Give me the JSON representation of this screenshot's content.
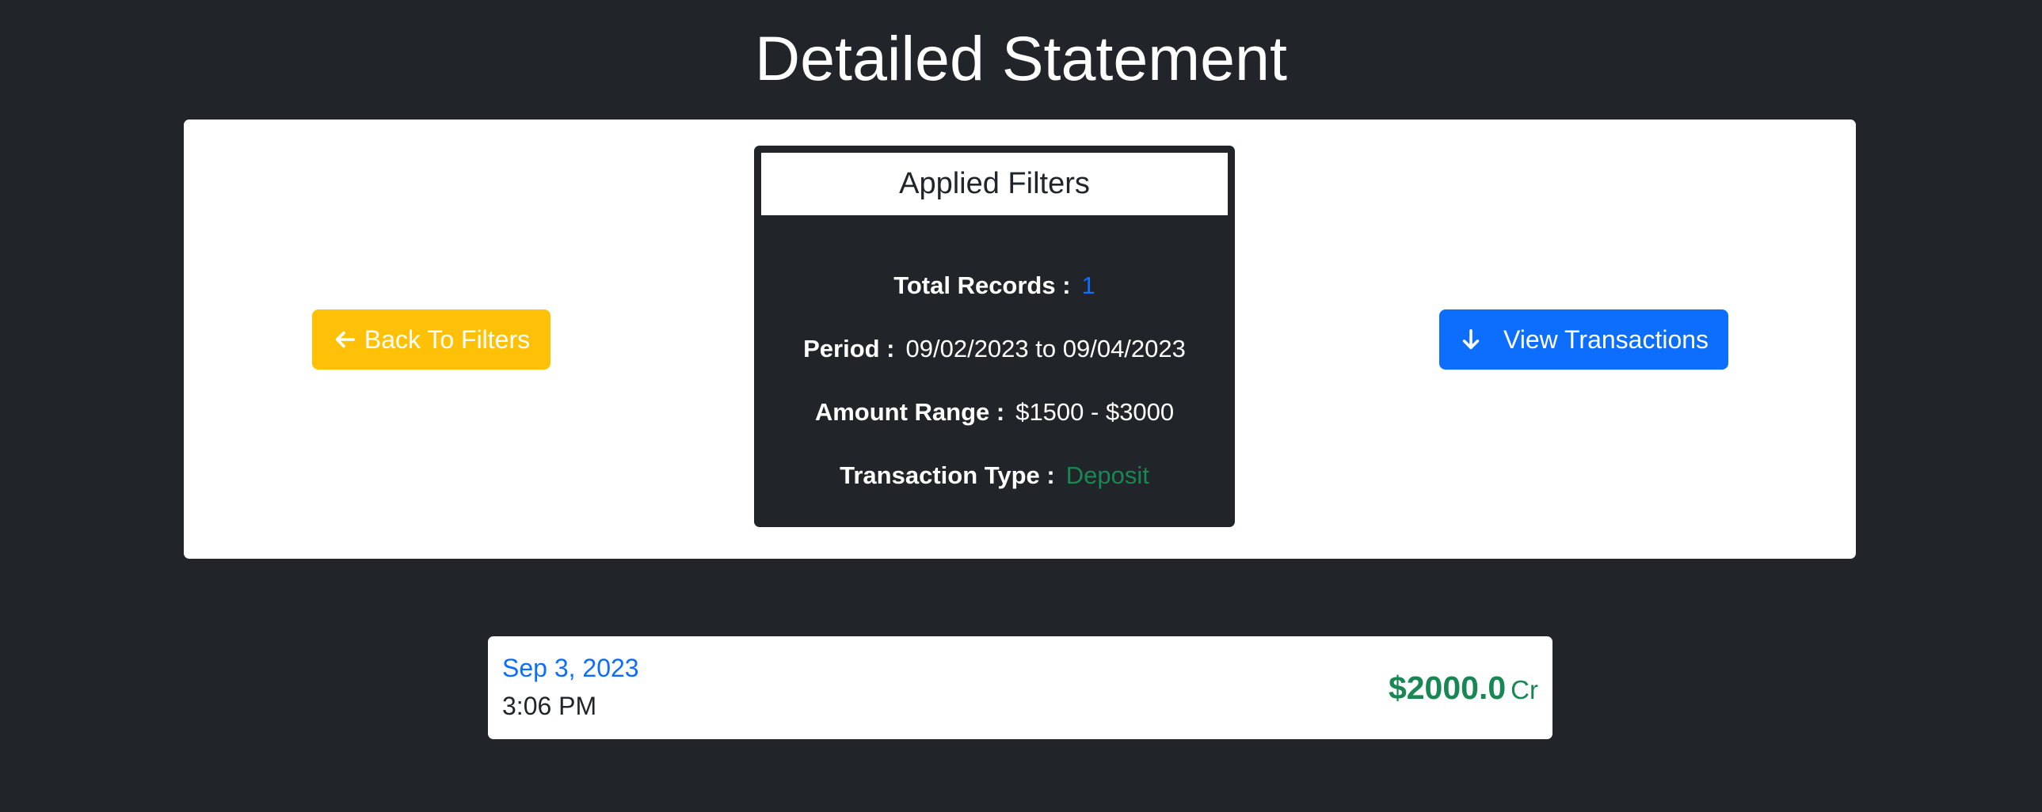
{
  "page": {
    "title": "Detailed Statement"
  },
  "actions": {
    "back_label": "Back To Filters",
    "back_icon": "arrow-left-icon",
    "view_label": "View Transactions",
    "view_icon": "arrow-down-icon"
  },
  "filters": {
    "header": "Applied Filters",
    "total_records_label": "Total Records :",
    "total_records_value": "1",
    "period_label": "Period :",
    "period_value": "09/02/2023 to 09/04/2023",
    "amount_range_label": "Amount Range :",
    "amount_range_value": "$1500 - $3000",
    "transaction_type_label": "Transaction Type :",
    "transaction_type_value": "Deposit"
  },
  "transactions": [
    {
      "date": "Sep 3, 2023",
      "time": "3:06 PM",
      "amount": "$2000.0",
      "type_suffix": "Cr"
    }
  ],
  "colors": {
    "background": "#212529",
    "panel": "#ffffff",
    "warning": "#ffc107",
    "primary": "#0d6efd",
    "success": "#198754"
  }
}
